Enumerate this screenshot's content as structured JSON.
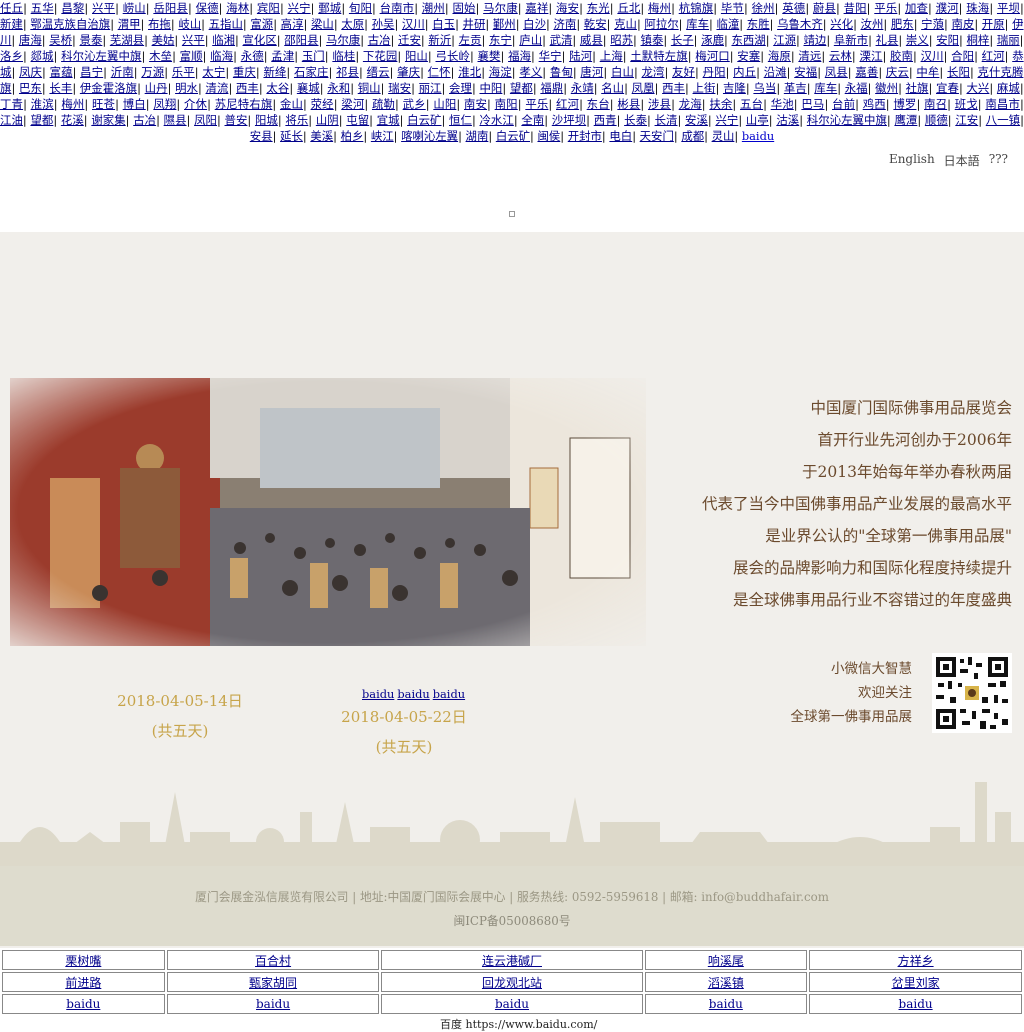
{
  "top_links": [
    "任丘",
    "五华",
    "昌黎",
    "兴平",
    "崂山",
    "岳阳县",
    "保德",
    "海林",
    "宾阳",
    "兴宁",
    "鄄城",
    "旬阳",
    "台南市",
    "潮州",
    "固始",
    "马尔康",
    "嘉祥",
    "海安",
    "东光",
    "丘北",
    "梅州",
    "杭锦旗",
    "毕节",
    "徐州",
    "英德",
    "蔚县",
    "昔阳",
    "平乐",
    "加查",
    "濮河",
    "珠海",
    "平坝",
    "新建",
    "鄂温克族自治旗",
    "渭甲",
    "布拖",
    "岐山",
    "五指山",
    "富源",
    "高淳",
    "梁山",
    "太原",
    "孙吴",
    "汉川",
    "白玉",
    "井研",
    "鄞州",
    "白沙",
    "济南",
    "乾安",
    "克山",
    "阿拉尔",
    "库车",
    "临潼",
    "东胜",
    "乌鲁木齐",
    "兴化",
    "汝州",
    "肥东",
    "宁蒗",
    "南皮",
    "开原",
    "伊川",
    "唐海",
    "吴桥",
    "景泰",
    "芜湖县",
    "美姑",
    "兴平",
    "临湘",
    "宣化区",
    "邵阳县",
    "马尔康",
    "古冶",
    "迁安",
    "新沂",
    "左贡",
    "东宁",
    "庐山",
    "武清",
    "威县",
    "昭苏",
    "镇泰",
    "长子",
    "涿鹿",
    "东西湖",
    "江源",
    "靖边",
    "阜新市",
    "礼县",
    "崇义",
    "安阳",
    "桐梓",
    "瑞丽",
    "洛乡",
    "郯城",
    "科尔沁左翼中旗",
    "木垒",
    "富顺",
    "临海",
    "永德",
    "孟津",
    "玉门",
    "临桂",
    "下花园",
    "阳山",
    "弓长岭",
    "襄樊",
    "福海",
    "华宁",
    "陆河",
    "上海",
    "土默特左旗",
    "梅河口",
    "安塞",
    "海原",
    "清远",
    "云林",
    "溧江",
    "胶南",
    "汉川",
    "合阳",
    "红河",
    "恭城",
    "凤庆",
    "富蕴",
    "昌宁",
    "沂南",
    "万源",
    "乐平",
    "太宁",
    "重庆",
    "新绛",
    "石家庄",
    "祁县",
    "缙云",
    "肇庆",
    "仁怀",
    "淮北",
    "海淀",
    "孝义",
    "鲁甸",
    "唐河",
    "白山",
    "龙湾",
    "友好",
    "丹阳",
    "内丘",
    "沿滩",
    "安福",
    "凤县",
    "嘉善",
    "庆云",
    "中牟",
    "长阳",
    "克什克腾旗",
    "巴东",
    "长丰",
    "伊金霍洛旗",
    "山丹",
    "明水",
    "清流",
    "西丰",
    "太谷",
    "襄城",
    "永和",
    "铜山",
    "瑞安",
    "丽江",
    "会理",
    "中阳",
    "望都",
    "福鼎",
    "永靖",
    "名山",
    "凤凰",
    "西丰",
    "上街",
    "吉隆",
    "乌当",
    "革吉",
    "库车",
    "永福",
    "徽州",
    "社旗",
    "宜春",
    "大兴",
    "麻城",
    "丁青",
    "淮滨",
    "梅州",
    "旺苍",
    "博白",
    "凤翔",
    "介休",
    "苏尼特右旗",
    "金山",
    "荥经",
    "梁河",
    "疏勒",
    "武乡",
    "山阳",
    "南安",
    "南阳",
    "平乐",
    "红河",
    "东台",
    "彬县",
    "涉县",
    "龙海",
    "扶余",
    "五台",
    "华池",
    "巴马",
    "台前",
    "鸡西",
    "博罗",
    "南召",
    "班戈",
    "南昌市",
    "江油",
    "望都",
    "花溪",
    "谢家集",
    "古冶",
    "隰县",
    "凤阳",
    "普安",
    "阳城",
    "将乐",
    "山阴",
    "屯留",
    "宜城",
    "白云矿",
    "恒仁",
    "冷水江",
    "全南",
    "沙坪坝",
    "西青",
    "长泰",
    "长清",
    "安溪",
    "兴宁",
    "山亭",
    "沽溪",
    "科尔沁左翼中旗",
    "鹰潭",
    "顺德",
    "江安",
    "八一镇",
    "安县",
    "延长",
    "美溪",
    "柏乡",
    "峡江",
    "喀喇沁左翼",
    "湖南",
    "白云矿",
    "闽侯",
    "开封市",
    "电白",
    "天安门",
    "成都",
    "灵山"
  ],
  "top_link_plain": "baidu",
  "lang": [
    "English",
    "日本語",
    "???"
  ],
  "hero": {
    "lines": [
      "中国厦门国际佛事用品展览会",
      "首开行业先河创办于2006年",
      "于2013年始每年举办春秋两届",
      "代表了当今中国佛事用品产业发展的最高水平",
      "是业界公认的\"全球第一佛事用品展\"",
      "展会的品牌影响力和国际化程度持续提升",
      "是全球佛事用品行业不容错过的年度盛典"
    ],
    "wechat": [
      "小微信大智慧",
      "欢迎关注",
      "全球第一佛事用品展"
    ]
  },
  "dates": [
    {
      "date": "2018-04-05-14日",
      "days": "(共五天)"
    },
    {
      "date": "2018-04-05-22日",
      "days": "(共五天)"
    }
  ],
  "small_links": [
    "baidu",
    "baidu",
    "baidu"
  ],
  "footer": {
    "line1": "厦门会展金泓信展览有限公司 | 地址:中国厦门国际会展中心 | 服务热线: 0592-5959618 | 邮箱: info@buddhafair.com",
    "line2": "闽ICP备05008680号"
  },
  "link_table": [
    [
      "栗树嘴",
      "百合村",
      "连云港碱厂",
      "响溪尾",
      "方祥乡"
    ],
    [
      "前进路",
      "甄家胡同",
      "回龙观北站",
      "滔溪镇",
      "岔里刘家"
    ],
    [
      "baidu",
      "baidu",
      "baidu",
      "baidu",
      "baidu"
    ]
  ],
  "bottom_cut": "百度 https://www.baidu.com/"
}
